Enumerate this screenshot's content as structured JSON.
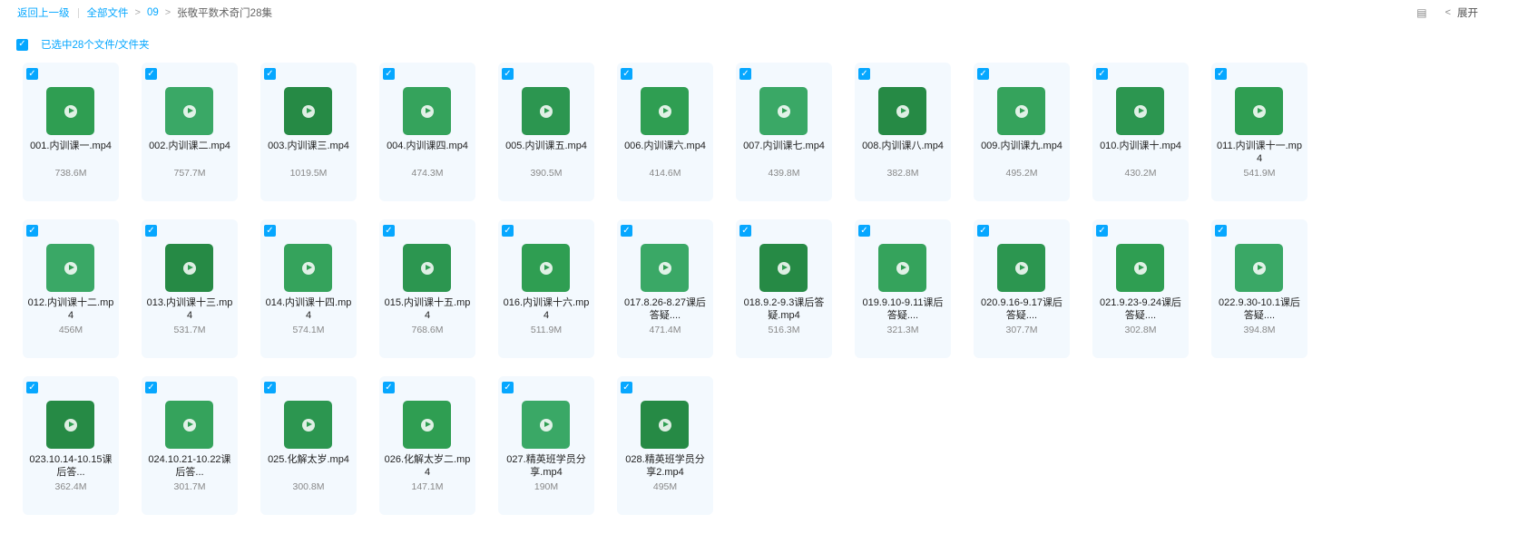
{
  "breadcrumb": {
    "back": "返回上一级",
    "all_files": "全部文件",
    "folder_parent": "09",
    "folder_current": "张敬平数术奇门28集"
  },
  "toolbar": {
    "grid_icon": "list-view-icon",
    "expand_label": "展开"
  },
  "selection": {
    "text": "已选中28个文件/文件夹"
  },
  "files": [
    {
      "name": "001.内训课一.mp4",
      "size": "738.6M"
    },
    {
      "name": "002.内训课二.mp4",
      "size": "757.7M"
    },
    {
      "name": "003.内训课三.mp4",
      "size": "1019.5M"
    },
    {
      "name": "004.内训课四.mp4",
      "size": "474.3M"
    },
    {
      "name": "005.内训课五.mp4",
      "size": "390.5M"
    },
    {
      "name": "006.内训课六.mp4",
      "size": "414.6M"
    },
    {
      "name": "007.内训课七.mp4",
      "size": "439.8M"
    },
    {
      "name": "008.内训课八.mp4",
      "size": "382.8M"
    },
    {
      "name": "009.内训课九.mp4",
      "size": "495.2M"
    },
    {
      "name": "010.内训课十.mp4",
      "size": "430.2M"
    },
    {
      "name": "011.内训课十一.mp4",
      "size": "541.9M"
    },
    {
      "name": "012.内训课十二.mp4",
      "size": "456M"
    },
    {
      "name": "013.内训课十三.mp4",
      "size": "531.7M"
    },
    {
      "name": "014.内训课十四.mp4",
      "size": "574.1M"
    },
    {
      "name": "015.内训课十五.mp4",
      "size": "768.6M"
    },
    {
      "name": "016.内训课十六.mp4",
      "size": "511.9M"
    },
    {
      "name": "017.8.26-8.27课后答疑....",
      "size": "471.4M"
    },
    {
      "name": "018.9.2-9.3课后答疑.mp4",
      "size": "516.3M"
    },
    {
      "name": "019.9.10-9.11课后答疑....",
      "size": "321.3M"
    },
    {
      "name": "020.9.16-9.17课后答疑....",
      "size": "307.7M"
    },
    {
      "name": "021.9.23-9.24课后答疑....",
      "size": "302.8M"
    },
    {
      "name": "022.9.30-10.1课后答疑....",
      "size": "394.8M"
    },
    {
      "name": "023.10.14-10.15课后答...",
      "size": "362.4M"
    },
    {
      "name": "024.10.21-10.22课后答...",
      "size": "301.7M"
    },
    {
      "name": "025.化解太岁.mp4",
      "size": "300.8M"
    },
    {
      "name": "026.化解太岁二.mp4",
      "size": "147.1M"
    },
    {
      "name": "027.精英班学员分享.mp4",
      "size": "190M"
    },
    {
      "name": "028.精英班学员分享2.mp4",
      "size": "495M"
    }
  ]
}
